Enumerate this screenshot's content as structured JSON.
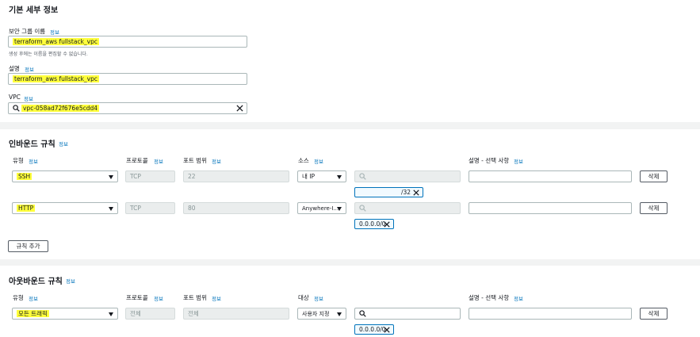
{
  "basic": {
    "title": "기본 세부 정보",
    "group_name_label": "보안 그룹 이름",
    "group_name_info": "정보",
    "group_name_value": "terraform_aws fullstack_vpc",
    "group_name_hint": "생성 후에는 이름을 편집할 수 없습니다.",
    "desc_label": "설명",
    "desc_info": "정보",
    "desc_value": "terraform_aws fullstack_vpc",
    "vpc_label": "VPC",
    "vpc_info": "정보",
    "vpc_value": "vpc-058ad72f676e5cdd4"
  },
  "inbound": {
    "title": "인바운드 규칙",
    "title_info": "정보",
    "headers": {
      "type": "유형",
      "type_info": "정보",
      "protocol": "프로토콜",
      "protocol_info": "정보",
      "port": "포트 범위",
      "port_info": "정보",
      "source": "소스",
      "source_info": "정보",
      "desc": "설명 - 선택 사항",
      "desc_info": "정보"
    },
    "rules": [
      {
        "type": "SSH",
        "protocol": "TCP",
        "port": "22",
        "source": "내 IP",
        "cidr": "/32",
        "delete": "삭제"
      },
      {
        "type": "HTTP",
        "protocol": "TCP",
        "port": "80",
        "source": "Anywhere-I...",
        "cidr": "0.0.0.0/0",
        "delete": "삭제"
      }
    ],
    "add_rule": "규칙 추가"
  },
  "outbound": {
    "title": "아웃바운드 규칙",
    "title_info": "정보",
    "headers": {
      "type": "유형",
      "type_info": "정보",
      "protocol": "프로토콜",
      "protocol_info": "정보",
      "port": "포트 범위",
      "port_info": "정보",
      "dest": "대상",
      "dest_info": "정보",
      "desc": "설명 - 선택 사항",
      "desc_info": "정보"
    },
    "rules": [
      {
        "type": "모든 트래픽",
        "protocol": "전체",
        "port": "전체",
        "dest": "사용자 지정",
        "cidr": "0.0.0.0/0",
        "delete": "삭제"
      }
    ]
  },
  "colors": {
    "link": "#0073bb",
    "highlight": "#ffff3b",
    "divider": "#f2f3f3"
  }
}
